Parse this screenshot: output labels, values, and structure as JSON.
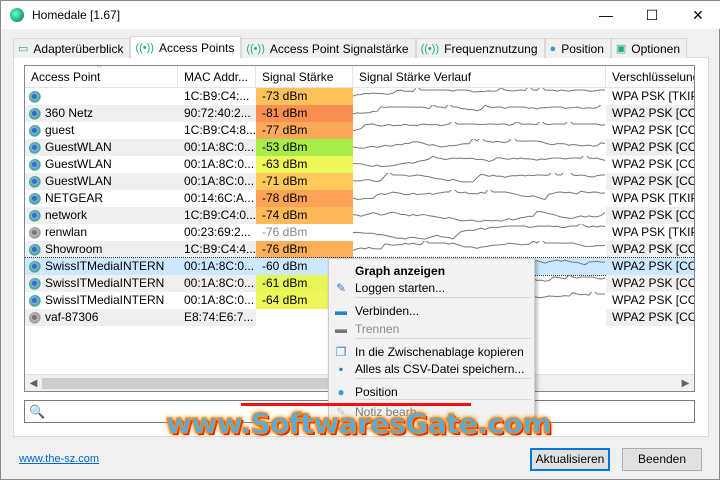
{
  "window": {
    "title": "Homedale [1.67]",
    "minimize": "—",
    "maximize": "☐",
    "close": "✕"
  },
  "tabs": [
    {
      "label": "Adapterüberblick",
      "icon": "adapter-icon",
      "active": false
    },
    {
      "label": "Access Points",
      "icon": "antenna-icon",
      "active": true
    },
    {
      "label": "Access Point Signalstärke",
      "icon": "antenna-icon",
      "active": false
    },
    {
      "label": "Frequenznutzung",
      "icon": "antenna-icon",
      "active": false
    },
    {
      "label": "Position",
      "icon": "location-pin-icon",
      "active": false
    },
    {
      "label": "Optionen",
      "icon": "options-icon",
      "active": false
    }
  ],
  "table": {
    "columns": [
      "Access Point",
      "MAC Addr...",
      "Signal Stärke",
      "Signal Stärke Verlauf",
      "Verschlüsselung"
    ],
    "sort_column": "Access Point",
    "rows": [
      {
        "ap": "",
        "mac": "1C:B9:C4:...",
        "signal": "-73 dBm",
        "color": "#fcc15a",
        "enc": "WPA PSK [TKIP]",
        "active": true
      },
      {
        "ap": "360 Netz",
        "mac": "90:72:40:2...",
        "signal": "-81 dBm",
        "color": "#fa8f52",
        "enc": "WPA2 PSK [CCM",
        "active": true
      },
      {
        "ap": "guest",
        "mac": "1C:B9:C4:8...",
        "signal": "-77 dBm",
        "color": "#fca95a",
        "enc": "WPA2 PSK [CCM",
        "active": true
      },
      {
        "ap": "GuestWLAN",
        "mac": "00:1A:8C:0...",
        "signal": "-53 dBm",
        "color": "#a8ec4c",
        "enc": "WPA2 PSK [CCM",
        "active": true
      },
      {
        "ap": "GuestWLAN",
        "mac": "00:1A:8C:0...",
        "signal": "-63 dBm",
        "color": "#eef65a",
        "enc": "WPA2 PSK [CCM",
        "active": true
      },
      {
        "ap": "GuestWLAN",
        "mac": "00:1A:8C:0...",
        "signal": "-71 dBm",
        "color": "#fcc95a",
        "enc": "WPA2 PSK [CCM",
        "active": true
      },
      {
        "ap": "NETGEAR",
        "mac": "00:14:6C:A...",
        "signal": "-78 dBm",
        "color": "#fca357",
        "enc": "WPA PSK [TKIP]",
        "active": true
      },
      {
        "ap": "network",
        "mac": "1C:B9:C4:0...",
        "signal": "-74 dBm",
        "color": "#fcb95a",
        "enc": "WPA2 PSK [CCM",
        "active": true
      },
      {
        "ap": "renwlan",
        "mac": "00:23:69:2...",
        "signal": "-76 dBm",
        "color": "",
        "enc": "WPA PSK [TKIP]",
        "active": false
      },
      {
        "ap": "Showroom",
        "mac": "1C:B9:C4:4...",
        "signal": "-76 dBm",
        "color": "#fcb05a",
        "enc": "WPA2 PSK [CCM",
        "active": true
      },
      {
        "ap": "SwissITMediaINTERN",
        "mac": "00:1A:8C:0...",
        "signal": "-60 dBm",
        "color": "",
        "enc": "WPA2 PSK [CCM",
        "active": true,
        "selected": true
      },
      {
        "ap": "SwissITMediaINTERN",
        "mac": "00:1A:8C:0...",
        "signal": "-61 dBm",
        "color": "#e6f658",
        "enc": "WPA2 PSK [CCM",
        "active": true
      },
      {
        "ap": "SwissITMediaINTERN",
        "mac": "00:1A:8C:0...",
        "signal": "-64 dBm",
        "color": "#eef65a",
        "enc": "WPA2 PSK [CCM",
        "active": true
      },
      {
        "ap": "vaf-87306",
        "mac": "E8:74:E6:7...",
        "signal": "",
        "color": "",
        "enc": "WPA2 PSK [CCM",
        "active": false
      }
    ]
  },
  "search": {
    "value": "",
    "placeholder": ""
  },
  "context_menu": [
    {
      "label": "Graph anzeigen",
      "icon": "",
      "bold": true,
      "disabled": false
    },
    {
      "label": "Loggen starten...",
      "icon": "log-icon",
      "disabled": false
    },
    {
      "label": "Verbinden...",
      "icon": "connect-icon",
      "disabled": false
    },
    {
      "label": "Trennen",
      "icon": "disconnect-icon",
      "disabled": true
    },
    {
      "label": "In die Zwischenablage kopieren",
      "icon": "copy-icon",
      "disabled": false
    },
    {
      "label": "Alles als CSV-Datei speichern...",
      "icon": "save-icon",
      "disabled": false
    },
    {
      "label": "Position",
      "icon": "location-pin-icon",
      "disabled": false
    },
    {
      "label": "Notiz bearb...",
      "icon": "note-icon",
      "disabled": false
    }
  ],
  "footer": {
    "link": "www.the-sz.com",
    "refresh": "Aktualisieren",
    "quit": "Beenden"
  },
  "watermark": "www.SoftwaresGate.com"
}
